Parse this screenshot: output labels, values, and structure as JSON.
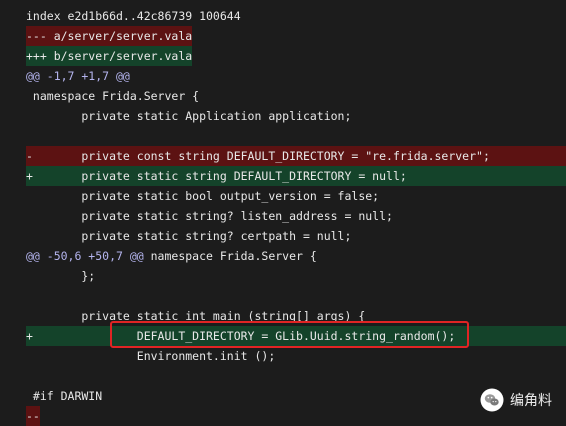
{
  "diff": {
    "lines": [
      {
        "type": "meta",
        "text": "index e2d1b66d..42c86739 100644"
      },
      {
        "type": "del-header",
        "text": "--- a/server/server.vala"
      },
      {
        "type": "add-header",
        "text": "+++ b/server/server.vala"
      },
      {
        "type": "hunk",
        "text": "@@ -1,7 +1,7 @@",
        "context": ""
      },
      {
        "type": "context",
        "text": " namespace Frida.Server {"
      },
      {
        "type": "context",
        "text": "        private static Application application;"
      },
      {
        "type": "context",
        "text": ""
      },
      {
        "type": "del",
        "marker": "-",
        "text": "        private const string DEFAULT_DIRECTORY = \"re.frida.server\";"
      },
      {
        "type": "add",
        "marker": "+",
        "text": "        private static string DEFAULT_DIRECTORY = null;"
      },
      {
        "type": "context",
        "text": "        private static bool output_version = false;"
      },
      {
        "type": "context",
        "text": "        private static string? listen_address = null;"
      },
      {
        "type": "context",
        "text": "        private static string? certpath = null;"
      },
      {
        "type": "hunk",
        "text": "@@ -50,6 +50,7 @@",
        "context": " namespace Frida.Server {"
      },
      {
        "type": "context",
        "text": "        };"
      },
      {
        "type": "context",
        "text": ""
      },
      {
        "type": "context",
        "text": "        private static int main (string[] args) {"
      },
      {
        "type": "add",
        "marker": "+",
        "text": "                DEFAULT_DIRECTORY = GLib.Uuid.string_random();"
      },
      {
        "type": "context",
        "text": "                Environment.init ();"
      },
      {
        "type": "context",
        "text": ""
      },
      {
        "type": "context",
        "text": " #if DARWIN"
      },
      {
        "type": "del-short",
        "text": "--"
      }
    ]
  },
  "watermark": {
    "label": "编角料",
    "icon": "wechat-icon"
  },
  "colors": {
    "background": "#1c1c1c",
    "deleted": "#5c1212",
    "added": "#14432a",
    "hunk": "#b4b4ee",
    "highlight": "#e02424"
  }
}
